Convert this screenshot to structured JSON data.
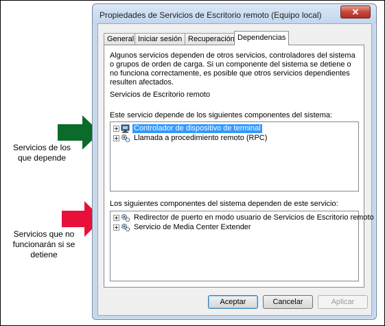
{
  "window": {
    "title": "Propiedades de Servicios de Escritorio remoto (Equipo local)",
    "close_glyph": "✕"
  },
  "tabs": [
    {
      "label": "General",
      "active": false
    },
    {
      "label": "Iniciar sesión",
      "active": false
    },
    {
      "label": "Recuperación",
      "active": false
    },
    {
      "label": "Dependencias",
      "active": true
    }
  ],
  "content": {
    "description": "Algunos servicios dependen de otros servicios, controladores del sistema o grupos de orden de carga. Si un componente del sistema se detiene o no funciona correctamente, es posible que otros servicios dependientes resulten afectados.",
    "service_name": "Servicios de Escritorio remoto",
    "depends_on_label": "Este servicio depende de los siguientes componentes del sistema:",
    "depends_on_items": [
      {
        "label": "Controlador de dispositivo de terminal",
        "icon": "driver-icon",
        "selected": true
      },
      {
        "label": "Llamada a procedimiento remoto (RPC)",
        "icon": "service-gear-icon",
        "selected": false
      }
    ],
    "dependents_label": "Los siguientes componentes del sistema dependen de este servicio:",
    "dependents_items": [
      {
        "label": "Redirector de puerto en modo usuario de Servicios de Escritorio remoto",
        "icon": "service-gear-icon"
      },
      {
        "label": "Servicio de Media Center Extender",
        "icon": "service-gear-icon"
      }
    ]
  },
  "buttons": {
    "accept": "Aceptar",
    "cancel": "Cancelar",
    "apply": "Aplicar"
  },
  "annotations": {
    "depends": "Servicios de los que depende",
    "would_stop": "Servicios que no funcionarán si se detiene"
  },
  "colors": {
    "green_arrow": "#0b6b2a",
    "red_arrow": "#e8103a",
    "selection": "#3399ff"
  }
}
